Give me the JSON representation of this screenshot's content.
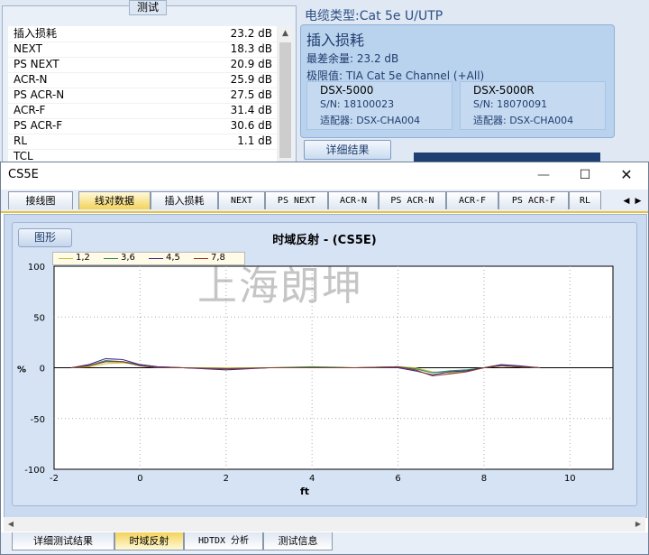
{
  "test_panel": {
    "group_title": "测试",
    "results": [
      {
        "name": "插入损耗",
        "value": "23.2 dB"
      },
      {
        "name": "NEXT",
        "value": "18.3 dB"
      },
      {
        "name": "PS NEXT",
        "value": "20.9 dB"
      },
      {
        "name": "ACR-N",
        "value": "25.9 dB"
      },
      {
        "name": "PS ACR-N",
        "value": "27.5 dB"
      },
      {
        "name": "ACR-F",
        "value": "31.4 dB"
      },
      {
        "name": "PS ACR-F",
        "value": "30.6 dB"
      },
      {
        "name": "RL",
        "value": "1.1 dB"
      },
      {
        "name": "TCL",
        "value": ""
      }
    ]
  },
  "cable": {
    "label": "电缆类型:",
    "value": "Cat 5e U/UTP"
  },
  "detail": {
    "title": "插入损耗",
    "worst_margin": "最差余量: 23.2 dB",
    "limit": "极限值: TIA Cat 5e Channel (+All)",
    "devices": [
      {
        "name": "DSX-5000",
        "sn": "S/N: 18100023",
        "adapter": "适配器: DSX-CHA004"
      },
      {
        "name": "DSX-5000R",
        "sn": "S/N: 18070091",
        "adapter": "适配器: DSX-CHA004"
      }
    ],
    "button": "详细结果"
  },
  "window": {
    "title": "CS5E",
    "min": "—",
    "max": "☐",
    "close": "✕"
  },
  "tabs": [
    "接线图",
    "线对数据",
    "插入损耗",
    "NEXT",
    "PS NEXT",
    "ACR-N",
    "PS ACR-N",
    "ACR-F",
    "PS ACR-F",
    "RL"
  ],
  "tab_scroll": {
    "left": "◀",
    "right": "▶"
  },
  "graph_button": "图形",
  "watermark": "上海朗坤",
  "bottom_tabs": [
    "详细测试结果",
    "时域反射",
    "HDTDX 分析",
    "测试信息"
  ],
  "chart_data": {
    "type": "line",
    "title": "时域反射 - (CS5E)",
    "xlabel": "ft",
    "ylabel": "%",
    "xlim": [
      -2,
      11
    ],
    "ylim": [
      -100,
      100
    ],
    "xticks": [
      -2,
      0,
      2,
      4,
      6,
      8,
      10
    ],
    "yticks": [
      100,
      50,
      0,
      -50,
      -100
    ],
    "grid": true,
    "legend": "top-left",
    "series": [
      {
        "name": "1,2",
        "color": "#c9c23a",
        "x": [
          -1.6,
          -1.2,
          -0.8,
          -0.4,
          0.0,
          0.4,
          1.0,
          2.0,
          3.0,
          4.0,
          5.0,
          6.0,
          6.4,
          6.8,
          7.2,
          7.6,
          8.0,
          8.4,
          8.8,
          9.3
        ],
        "y": [
          0,
          1,
          4,
          5,
          3,
          1,
          0,
          0,
          0,
          0,
          0,
          1,
          0,
          -4,
          -5,
          -3,
          0,
          3,
          1,
          0
        ]
      },
      {
        "name": "3,6",
        "color": "#2e8b57",
        "x": [
          -1.6,
          -1.2,
          -0.8,
          -0.4,
          0.0,
          0.4,
          1.0,
          2.0,
          3.0,
          4.0,
          5.0,
          6.0,
          6.4,
          6.8,
          7.2,
          7.6,
          8.0,
          8.4,
          8.8,
          9.3
        ],
        "y": [
          0,
          2,
          7,
          6,
          3,
          1,
          0,
          -1,
          0,
          1,
          0,
          1,
          -1,
          -5,
          -3,
          -2,
          0,
          2,
          1,
          0
        ]
      },
      {
        "name": "4,5",
        "color": "#3a2a8c",
        "x": [
          -1.6,
          -1.2,
          -0.8,
          -0.4,
          0.0,
          0.4,
          1.0,
          2.0,
          3.0,
          4.0,
          5.0,
          6.0,
          6.4,
          6.8,
          7.2,
          7.6,
          8.0,
          8.4,
          8.8,
          9.3
        ],
        "y": [
          0,
          3,
          9,
          8,
          3,
          1,
          0,
          -2,
          0,
          0,
          0,
          0,
          -3,
          -7,
          -4,
          -3,
          0,
          3,
          2,
          0
        ]
      },
      {
        "name": "7,8",
        "color": "#8b3a2a",
        "x": [
          -1.6,
          -1.2,
          -0.8,
          -0.4,
          0.0,
          0.4,
          1.0,
          2.0,
          3.0,
          4.0,
          5.0,
          6.0,
          6.4,
          6.8,
          7.2,
          7.6,
          8.0,
          8.4,
          8.8,
          9.3
        ],
        "y": [
          0,
          2,
          6,
          6,
          2,
          0,
          0,
          -1,
          0,
          0,
          0,
          1,
          -2,
          -8,
          -6,
          -4,
          0,
          2,
          1,
          0
        ]
      }
    ]
  }
}
